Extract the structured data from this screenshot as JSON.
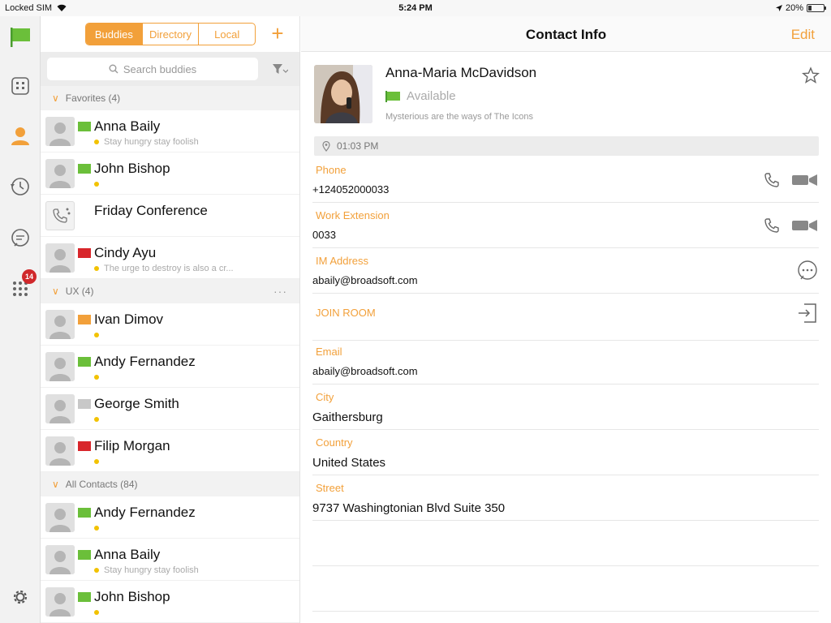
{
  "status_bar": {
    "carrier": "Locked SIM",
    "time": "5:24 PM",
    "battery": "20%",
    "battery_level": 0.2
  },
  "rail": {
    "items": [
      "flag-icon",
      "building-icon",
      "person-icon",
      "history-icon",
      "chat-icon",
      "dialpad-icon",
      "settings-icon"
    ],
    "dialpad_badge": "14",
    "accent": "#f2a03a"
  },
  "buddies": {
    "tabs": [
      "Buddies",
      "Directory",
      "Local"
    ],
    "active_tab": "Buddies",
    "search_placeholder": "Search buddies",
    "groups": [
      {
        "label": "Favorites (4)",
        "items": [
          {
            "name": "Anna Baily",
            "status": "Stay hungry stay foolish",
            "flag": "green"
          },
          {
            "name": "John Bishop",
            "status": "",
            "flag": "green"
          },
          {
            "name": "Friday Conference",
            "status": "",
            "flag": "none"
          },
          {
            "name": "Cindy Ayu",
            "status": "The urge to destroy is also a cr...",
            "flag": "red"
          }
        ]
      },
      {
        "label": "UX (4)",
        "items": [
          {
            "name": "Ivan Dimov",
            "status": "",
            "flag": "orange"
          },
          {
            "name": "Andy Fernandez",
            "status": "",
            "flag": "green"
          },
          {
            "name": "George Smith",
            "status": "",
            "flag": "gray"
          },
          {
            "name": "Filip Morgan",
            "status": "",
            "flag": "red"
          }
        ]
      },
      {
        "label": "All Contacts (84)",
        "items": [
          {
            "name": "Andy Fernandez",
            "status": "",
            "flag": "green"
          },
          {
            "name": "Anna Baily",
            "status": "Stay hungry stay foolish",
            "flag": "green"
          },
          {
            "name": "John Bishop",
            "status": "",
            "flag": "green"
          }
        ]
      }
    ]
  },
  "contact": {
    "header_title": "Contact Info",
    "edit_label": "Edit",
    "name": "Anna-Maria McDavidson",
    "availability": "Available",
    "status_message": "Mysterious are the ways of The Icons",
    "local_time": "01:03 PM",
    "phone_label": "Phone",
    "phone": "+124052000033",
    "work_ext_label": "Work Extension",
    "work_ext": "0033",
    "im_label": "IM Address",
    "im": "abaily@broadsoft.com",
    "join_room_label": "JOIN ROOM",
    "email_label": "Email",
    "email": "abaily@broadsoft.com",
    "city_label": "City",
    "city": "Gaithersburg",
    "country_label": "Country",
    "country": "United States",
    "street_label": "Street",
    "street": "9737 Washingtonian Blvd Suite 350"
  }
}
